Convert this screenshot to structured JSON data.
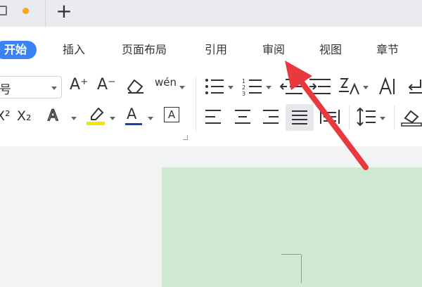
{
  "tabs": {
    "new_tab_label": "+"
  },
  "menu": [
    {
      "label": "开始",
      "active": true
    },
    {
      "label": "插入"
    },
    {
      "label": "页面布局"
    },
    {
      "label": "引用"
    },
    {
      "label": "审阅"
    },
    {
      "label": "视图"
    },
    {
      "label": "章节"
    }
  ],
  "font": {
    "size_value": "号"
  },
  "toolbar": {
    "grow_font": "A⁺",
    "shrink_font": "A⁻",
    "pinyin": "wén",
    "superscript": "X²",
    "subscript": "X₂",
    "text_effect": "A",
    "font_color": "A",
    "char_border": "A"
  },
  "colors": {
    "accent": "#3b82f6",
    "highlight_yellow": "#f5e600",
    "font_color_underline": "#1e3fb3",
    "arrow": "#e8393e",
    "page_bg": "#cfe8d2"
  },
  "icons": [
    "document-icon",
    "unsaved-dot-icon",
    "plus-icon",
    "eraser-icon",
    "pinyin-icon",
    "highlighter-icon",
    "bullets-icon",
    "numbering-icon",
    "outdent-icon",
    "indent-icon",
    "sort-icon",
    "line-spacing-icon",
    "align-left-icon",
    "align-center-icon",
    "align-right-icon",
    "justify-icon",
    "distribute-icon",
    "show-marks-icon",
    "shading-icon",
    "red-arrow-annotation"
  ]
}
